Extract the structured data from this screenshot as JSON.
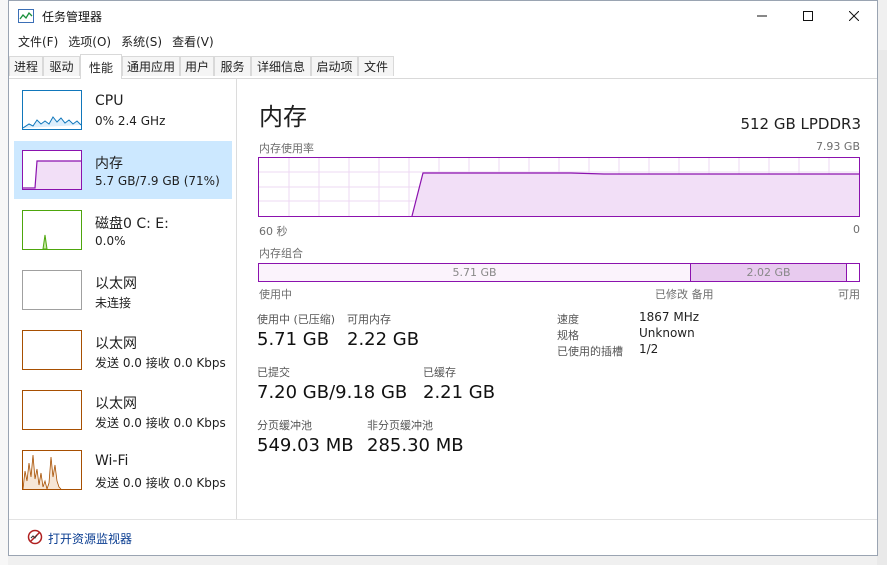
{
  "window": {
    "title": "任务管理器"
  },
  "menu": [
    "文件(F)",
    "选项(O)",
    "系统(S)",
    "查看(V)"
  ],
  "tabs": [
    "进程",
    "驱动",
    "性能",
    "通用应用",
    "用户",
    "服务",
    "详细信息",
    "启动项",
    "文件"
  ],
  "sidebar": [
    {
      "title": "CPU",
      "sub": "0%  2.4 GHz",
      "color": "#1177bb"
    },
    {
      "title": "内存",
      "sub": "5.7 GB/7.9 GB  (71%)",
      "color": "#8b12ae"
    },
    {
      "title": "磁盘0  C: E:",
      "sub": "0.0%",
      "color": "#4da60c"
    },
    {
      "title": "以太网",
      "sub": "未连接",
      "color": "#a0a0a0"
    },
    {
      "title": "以太网",
      "sub": "发送 0.0 接收 0.0 Kbps",
      "color": "#a74f01"
    },
    {
      "title": "以太网",
      "sub": "发送 0.0 接收 0.0 Kbps",
      "color": "#a74f01"
    },
    {
      "title": "Wi-Fi",
      "sub": "发送 0.0 接收 0.0 Kbps",
      "color": "#a74f01"
    }
  ],
  "main": {
    "title": "内存",
    "spec": "512 GB  LPDDR3",
    "usage_label": "内存使用率",
    "usage_max": "7.93 GB",
    "time_left": "60 秒",
    "time_right": "0",
    "composition_label": "内存组合",
    "composition": {
      "in_use": "5.71 GB",
      "modified": "2.02 GB",
      "in_use_frac": 0.72,
      "modified_frac": 0.26
    },
    "composition_legend": {
      "in_use": "使用中",
      "modified_standby": "已修改 备用",
      "available": "可用"
    },
    "stats": {
      "in_use_label": "使用中 (已压缩)",
      "in_use_val": "5.71 GB",
      "available_label": "可用内存",
      "available_val": "2.22 GB",
      "committed_label": "已提交",
      "committed_val": "7.20 GB/9.18 GB",
      "cached_label": "已缓存",
      "cached_val": "2.21 GB",
      "paged_label": "分页缓冲池",
      "paged_val": "549.03 MB",
      "nonpaged_label": "非分页缓冲池",
      "nonpaged_val": "285.30 MB"
    },
    "details": {
      "speed_label": "速度",
      "speed_val": "1867 MHz",
      "form_label": "规格",
      "form_val": "Unknown",
      "slots_label": "已使用的插槽",
      "slots_val": "1/2"
    }
  },
  "footer": {
    "link": "打开资源监视器"
  }
}
